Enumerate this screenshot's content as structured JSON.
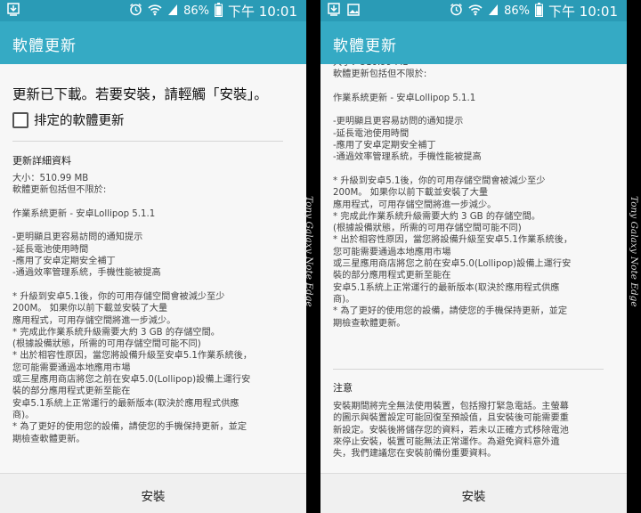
{
  "status": {
    "battery": "86%",
    "time": "下午 10:01"
  },
  "app": {
    "title": "軟體更新"
  },
  "left": {
    "downloaded": "更新已下載。若要安裝，請輕觸「安裝」。",
    "scheduled_label": "排定的軟體更新",
    "details_title": "更新詳細資料",
    "body": "大小：510.99 MB\n軟體更新包括但不限於:\n\n作業系統更新 - 安卓Lollipop 5.1.1\n\n-更明顯且更容易訪問的通知提示\n-延長電池使用時間\n-應用了安卓定期安全補丁\n-通過效率管理系統，手機性能被提高\n\n* 升級到安卓5.1後，你的可用存儲空間會被減少至少\n200M。 如果你以前下載並安裝了大量\n應用程式，可用存儲空間將進一步減少。\n* 完成此作業系統升級需要大約 3 GB 的存儲空間。\n(根據設備狀態，所需的可用存儲空間可能不同)\n* 出於相容性原因，當您將設備升級至安卓5.1作業系統後，\n您可能需要通過本地應用市場\n或三星應用商店將您之前在安卓5.0(Lollipop)設備上運行安\n裝的部分應用程式更新至能在\n安卓5.1系統上正常運行的最新版本(取決於應用程式供應\n商)。\n* 為了更好的使用您的設備，請使您的手機保持更新，並定\n期檢查軟體更新。"
  },
  "right": {
    "body": "大小：510.99 MB\n軟體更新包括但不限於:\n\n作業系統更新 - 安卓Lollipop 5.1.1\n\n-更明顯且更容易訪問的通知提示\n-延長電池使用時間\n-應用了安卓定期安全補丁\n-通過效率管理系統，手機性能被提高\n\n* 升級到安卓5.1後，你的可用存儲空間會被減少至少\n200M。 如果你以前下載並安裝了大量\n應用程式，可用存儲空間將進一步減少。\n* 完成此作業系統升級需要大約 3 GB 的存儲空間。\n(根據設備狀態，所需的可用存儲空間可能不同)\n* 出於相容性原因，當您將設備升級至安卓5.1作業系統後，\n您可能需要通過本地應用市場\n或三星應用商店將您之前在安卓5.0(Lollipop)設備上運行安\n裝的部分應用程式更新至能在\n安卓5.1系統上正常運行的最新版本(取決於應用程式供應\n商)。\n* 為了更好的使用您的設備，請使您的手機保持更新，並定\n期檢查軟體更新。",
    "notice_title": "注意",
    "notice_body": "安裝期間將完全無法使用裝置，包括撥打緊急電話。主螢幕\n的圖示與裝置設定可能回復至預設值，且安裝後可能需要重\n新設定。安裝後將儲存您的資料，若未以正確方式移除電池\n來停止安裝，裝置可能無法正常運作。為避免資料意外遺\n失，我們建議您在安裝前備份重要資料。"
  },
  "bottom": {
    "install_label": "安裝"
  },
  "watermark": {
    "text": "Tony Galaxy Note Edge"
  },
  "colors": {
    "status_bar": "#2a9bb6",
    "app_bar": "#35aac4",
    "background": "#f7f7f7"
  },
  "icons": [
    "download-notification-icon",
    "image-notification-icon",
    "alarm-icon",
    "wifi-icon",
    "signal-icon",
    "battery-icon"
  ]
}
